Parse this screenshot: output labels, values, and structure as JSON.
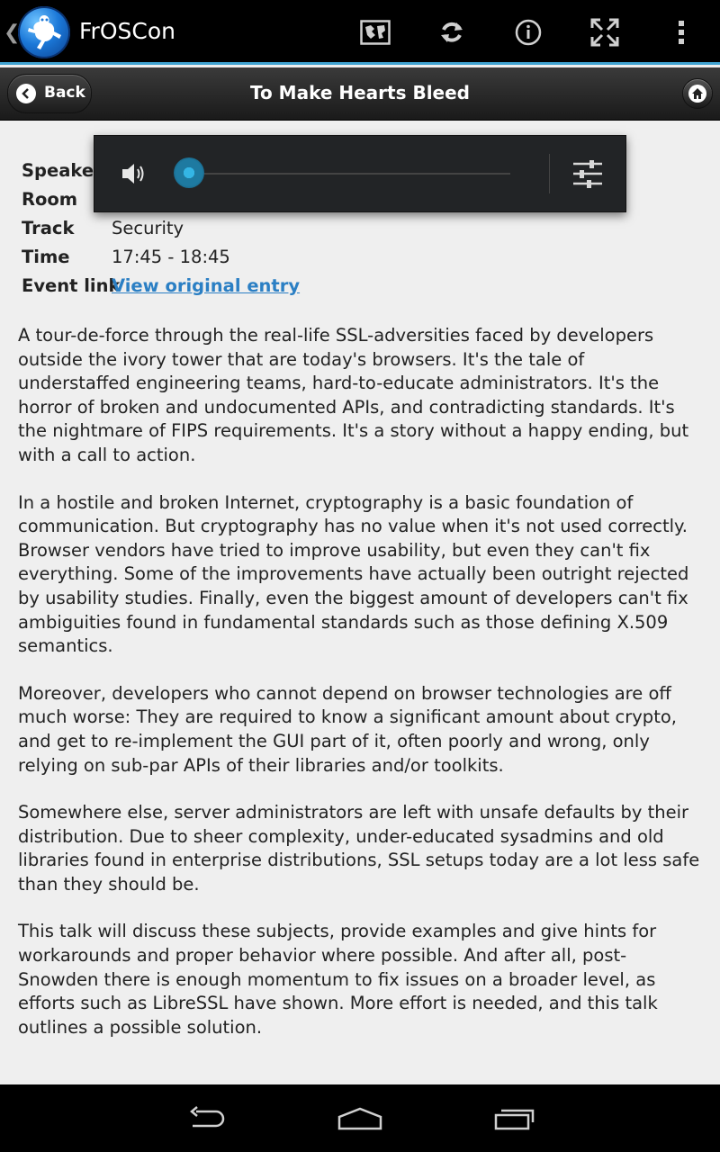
{
  "app": {
    "title": "FrOSCon"
  },
  "actionbar": {
    "icons": [
      "map-icon",
      "refresh-icon",
      "info-icon",
      "fullscreen-icon",
      "overflow-menu-icon"
    ]
  },
  "header": {
    "back_label": "Back",
    "title": "To Make Hearts Bleed"
  },
  "details": {
    "speaker_label": "Speaker",
    "room_label": "Room",
    "track_label": "Track",
    "track_value": "Security",
    "time_label": "Time",
    "time_value": "17:45 - 18:45",
    "event_link_label": "Event link",
    "event_link_value": "View original entry"
  },
  "description": [
    "A tour-de-force through the real-life SSL-adversities faced by developers outside the ivory tower that are today's browsers. It's the tale of understaffed engineering teams, hard-to-educate administrators. It's the horror of broken and undocumented APIs, and contradicting standards. It's the nightmare of FIPS requirements. It's a story without a happy ending, but with a call to action.",
    "In a hostile and broken Internet, cryptography is a basic foundation of communication. But cryptography has no value when it's not used correctly. Browser vendors have tried to improve usability, but even they can't fix everything. Some of the improvements have actually been outright rejected by usability studies. Finally, even the biggest amount of developers can't fix ambiguities found in fundamental standards such as those defining X.509 semantics.",
    "Moreover, developers who cannot depend on browser technologies are off much worse: They are required to know a significant amount about crypto, and get to re-implement the GUI part of it, often poorly and wrong, only relying on sub-par APIs of their libraries and/or toolkits.",
    "Somewhere else, server administrators are left with unsafe defaults by their distribution. Due to sheer complexity, under-educated sysadmins and old libraries found in enterprise distributions, SSL setups today are a lot less safe than they should be.",
    "This talk will discuss these subjects, provide examples and give hints for workarounds and proper behavior where possible. And after all, post-Snowden there is enough momentum to fix issues on a broader level, as efforts such as LibreSSL have shown. More effort is needed, and this talk outlines a possible solution."
  ],
  "volume_overlay": {
    "level": 0.0,
    "accent": "#34b5e5"
  },
  "colors": {
    "accent_line": "#3fa2d1",
    "link": "#2b7fc4"
  }
}
